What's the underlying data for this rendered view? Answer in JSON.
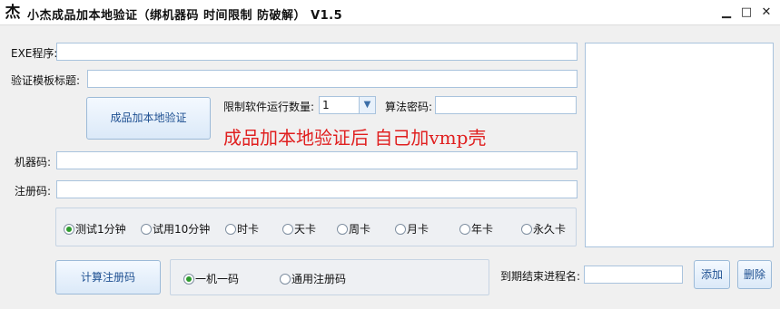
{
  "window": {
    "title": "小杰成品加本地验证（绑机器码 时间限制 防破解） V1.5",
    "icon_glyph": "杰",
    "minimize_glyph": "▁",
    "maximize_glyph": "□",
    "close_glyph": "✕"
  },
  "form": {
    "exe_label": "EXE程序:",
    "exe_value": "",
    "title_label": "验证模板标题:",
    "title_value": "",
    "local_verify_button": "成品加本地验证",
    "limit_label": "限制软件运行数量:",
    "limit_value": "1",
    "algo_label": "算法密码:",
    "algo_value": "",
    "note": "成品加本地验证后 自己加vmp壳",
    "machine_label": "机器码:",
    "machine_value": "",
    "reg_label": "注册码:",
    "reg_value": ""
  },
  "duration_options": [
    {
      "label": "测试1分钟",
      "selected": true
    },
    {
      "label": "试用10分钟",
      "selected": false
    },
    {
      "label": "时卡",
      "selected": false
    },
    {
      "label": "天卡",
      "selected": false
    },
    {
      "label": "周卡",
      "selected": false
    },
    {
      "label": "月卡",
      "selected": false
    },
    {
      "label": "年卡",
      "selected": false
    },
    {
      "label": "永久卡",
      "selected": false
    }
  ],
  "bottom": {
    "calc_button": "计算注册码",
    "mode_options": [
      {
        "label": "一机一码",
        "selected": true
      },
      {
        "label": "通用注册码",
        "selected": false
      }
    ],
    "process_label": "到期结束进程名:",
    "process_value": "",
    "add_button": "添加",
    "delete_button": "删除"
  },
  "colors": {
    "note_red": "#e02020",
    "button_text_blue": "#1d4f91",
    "radio_selected_green": "#2e9b2e"
  }
}
